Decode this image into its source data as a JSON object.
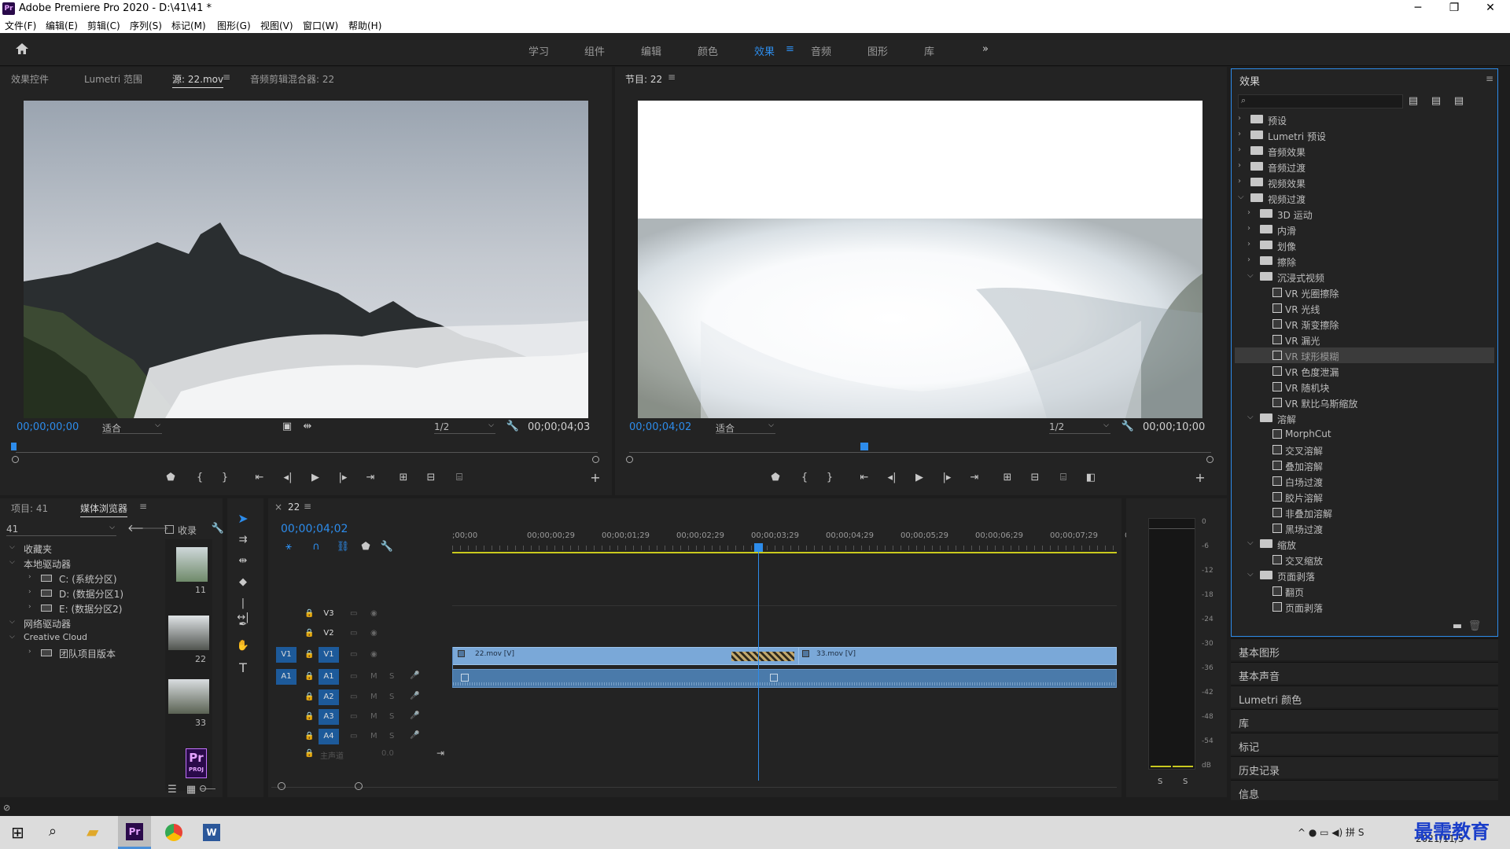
{
  "window": {
    "title": "Adobe Premiere Pro 2020 - D:\\41\\41 *",
    "logo": "Pr",
    "controls": [
      "─",
      "❐",
      "✕"
    ]
  },
  "menu": [
    "文件(F)",
    "编辑(E)",
    "剪辑(C)",
    "序列(S)",
    "标记(M)",
    "图形(G)",
    "视图(V)",
    "窗口(W)",
    "帮助(H)"
  ],
  "workspaces": [
    "学习",
    "组件",
    "编辑",
    "颜色",
    "效果",
    "音频",
    "图形",
    "库"
  ],
  "active_workspace": "效果",
  "source_panel": {
    "tabs": [
      "效果控件",
      "Lumetri 范围",
      "源: 22.mov",
      "音频剪辑混合器: 22"
    ],
    "timecode": "00;00;00;00",
    "fit": "适合",
    "resolution": "1/2",
    "duration": "00;00;04;03"
  },
  "program_panel": {
    "tab": "节目: 22",
    "timecode": "00;00;04;02",
    "fit": "适合",
    "resolution": "1/2",
    "duration": "00;00;10;00"
  },
  "project_panel": {
    "tabs": [
      "项目: 41",
      "媒体浏览器"
    ],
    "folder": "41",
    "favorites_label": "收录",
    "tree": [
      {
        "label": "收藏夹",
        "level": 0
      },
      {
        "label": "本地驱动器",
        "level": 0
      },
      {
        "label": "C: (系统分区)",
        "level": 1
      },
      {
        "label": "D: (数据分区1)",
        "level": 1
      },
      {
        "label": "E: (数据分区2)",
        "level": 1
      },
      {
        "label": "网络驱动器",
        "level": 0
      },
      {
        "label": "Creative Cloud",
        "level": 0
      },
      {
        "label": "团队项目版本",
        "level": 1
      }
    ],
    "thumbs": [
      "11",
      "22",
      "33"
    ],
    "proj_label": "PROJ"
  },
  "timeline": {
    "tab": "22",
    "timecode": "00;00;04;02",
    "ruler": [
      ";00;00",
      "00;00;00;29",
      "00;00;01;29",
      "00;00;02;29",
      "00;00;03;29",
      "00;00;04;29",
      "00;00;05;29",
      "00;00;06;29",
      "00;00;07;29",
      "00;"
    ],
    "video_tracks": [
      "V3",
      "V2",
      "V1"
    ],
    "audio_tracks": [
      "A1",
      "A2",
      "A3",
      "A4"
    ],
    "master": "主声道",
    "master_value": "0.0",
    "clip1": "22.mov [V]",
    "clip2": "33.mov [V]",
    "source_v1": "V1",
    "source_a1": "A1"
  },
  "meter": {
    "labels": [
      "0",
      "-6",
      "-12",
      "-18",
      "-24",
      "-30",
      "-36",
      "-42",
      "-48",
      "-54",
      "dB"
    ],
    "solo": [
      "S",
      "S"
    ]
  },
  "effects": {
    "title": "效果",
    "search_placeholder": "",
    "items": [
      {
        "label": "预设",
        "type": "folder",
        "level": 0,
        "open": false
      },
      {
        "label": "Lumetri 预设",
        "type": "folder",
        "level": 0,
        "open": false
      },
      {
        "label": "音频效果",
        "type": "folder",
        "level": 0,
        "open": false
      },
      {
        "label": "音频过渡",
        "type": "folder",
        "level": 0,
        "open": false
      },
      {
        "label": "视频效果",
        "type": "folder",
        "level": 0,
        "open": false
      },
      {
        "label": "视频过渡",
        "type": "folder",
        "level": 0,
        "open": true
      },
      {
        "label": "3D 运动",
        "type": "folder",
        "level": 1,
        "open": false
      },
      {
        "label": "内滑",
        "type": "folder",
        "level": 1,
        "open": false
      },
      {
        "label": "划像",
        "type": "folder",
        "level": 1,
        "open": false
      },
      {
        "label": "擦除",
        "type": "folder",
        "level": 1,
        "open": false
      },
      {
        "label": "沉浸式视频",
        "type": "folder",
        "level": 1,
        "open": true
      },
      {
        "label": "VR 光圈擦除",
        "type": "fx",
        "level": 2
      },
      {
        "label": "VR 光线",
        "type": "fx",
        "level": 2
      },
      {
        "label": "VR 渐变擦除",
        "type": "fx",
        "level": 2
      },
      {
        "label": "VR 漏光",
        "type": "fx",
        "level": 2
      },
      {
        "label": "VR 球形模糊",
        "type": "fx",
        "level": 2,
        "selected": true
      },
      {
        "label": "VR 色度泄漏",
        "type": "fx",
        "level": 2
      },
      {
        "label": "VR 随机块",
        "type": "fx",
        "level": 2
      },
      {
        "label": "VR 默比乌斯缩放",
        "type": "fx",
        "level": 2
      },
      {
        "label": "溶解",
        "type": "folder",
        "level": 1,
        "open": true
      },
      {
        "label": "MorphCut",
        "type": "fx",
        "level": 2
      },
      {
        "label": "交叉溶解",
        "type": "fx",
        "level": 2
      },
      {
        "label": "叠加溶解",
        "type": "fx",
        "level": 2
      },
      {
        "label": "白场过渡",
        "type": "fx",
        "level": 2
      },
      {
        "label": "胶片溶解",
        "type": "fx",
        "level": 2
      },
      {
        "label": "非叠加溶解",
        "type": "fx",
        "level": 2
      },
      {
        "label": "黑场过渡",
        "type": "fx",
        "level": 2
      },
      {
        "label": "缩放",
        "type": "folder",
        "level": 1,
        "open": true
      },
      {
        "label": "交叉缩放",
        "type": "fx",
        "level": 2
      },
      {
        "label": "页面剥落",
        "type": "folder",
        "level": 1,
        "open": true
      },
      {
        "label": "翻页",
        "type": "fx",
        "level": 2
      },
      {
        "label": "页面剥落",
        "type": "fx",
        "level": 2
      }
    ]
  },
  "side_sections": [
    "基本图形",
    "基本声音",
    "Lumetri 颜色",
    "库",
    "标记",
    "历史记录",
    "信息"
  ],
  "taskbar": {
    "date": "2021/11/5",
    "watermark": "最需教育"
  },
  "colors": {
    "accent": "#2d8ceb",
    "clip_video": "#7aa8d8",
    "clip_audio": "#4a7aaa",
    "playhead": "#2d8ceb"
  }
}
